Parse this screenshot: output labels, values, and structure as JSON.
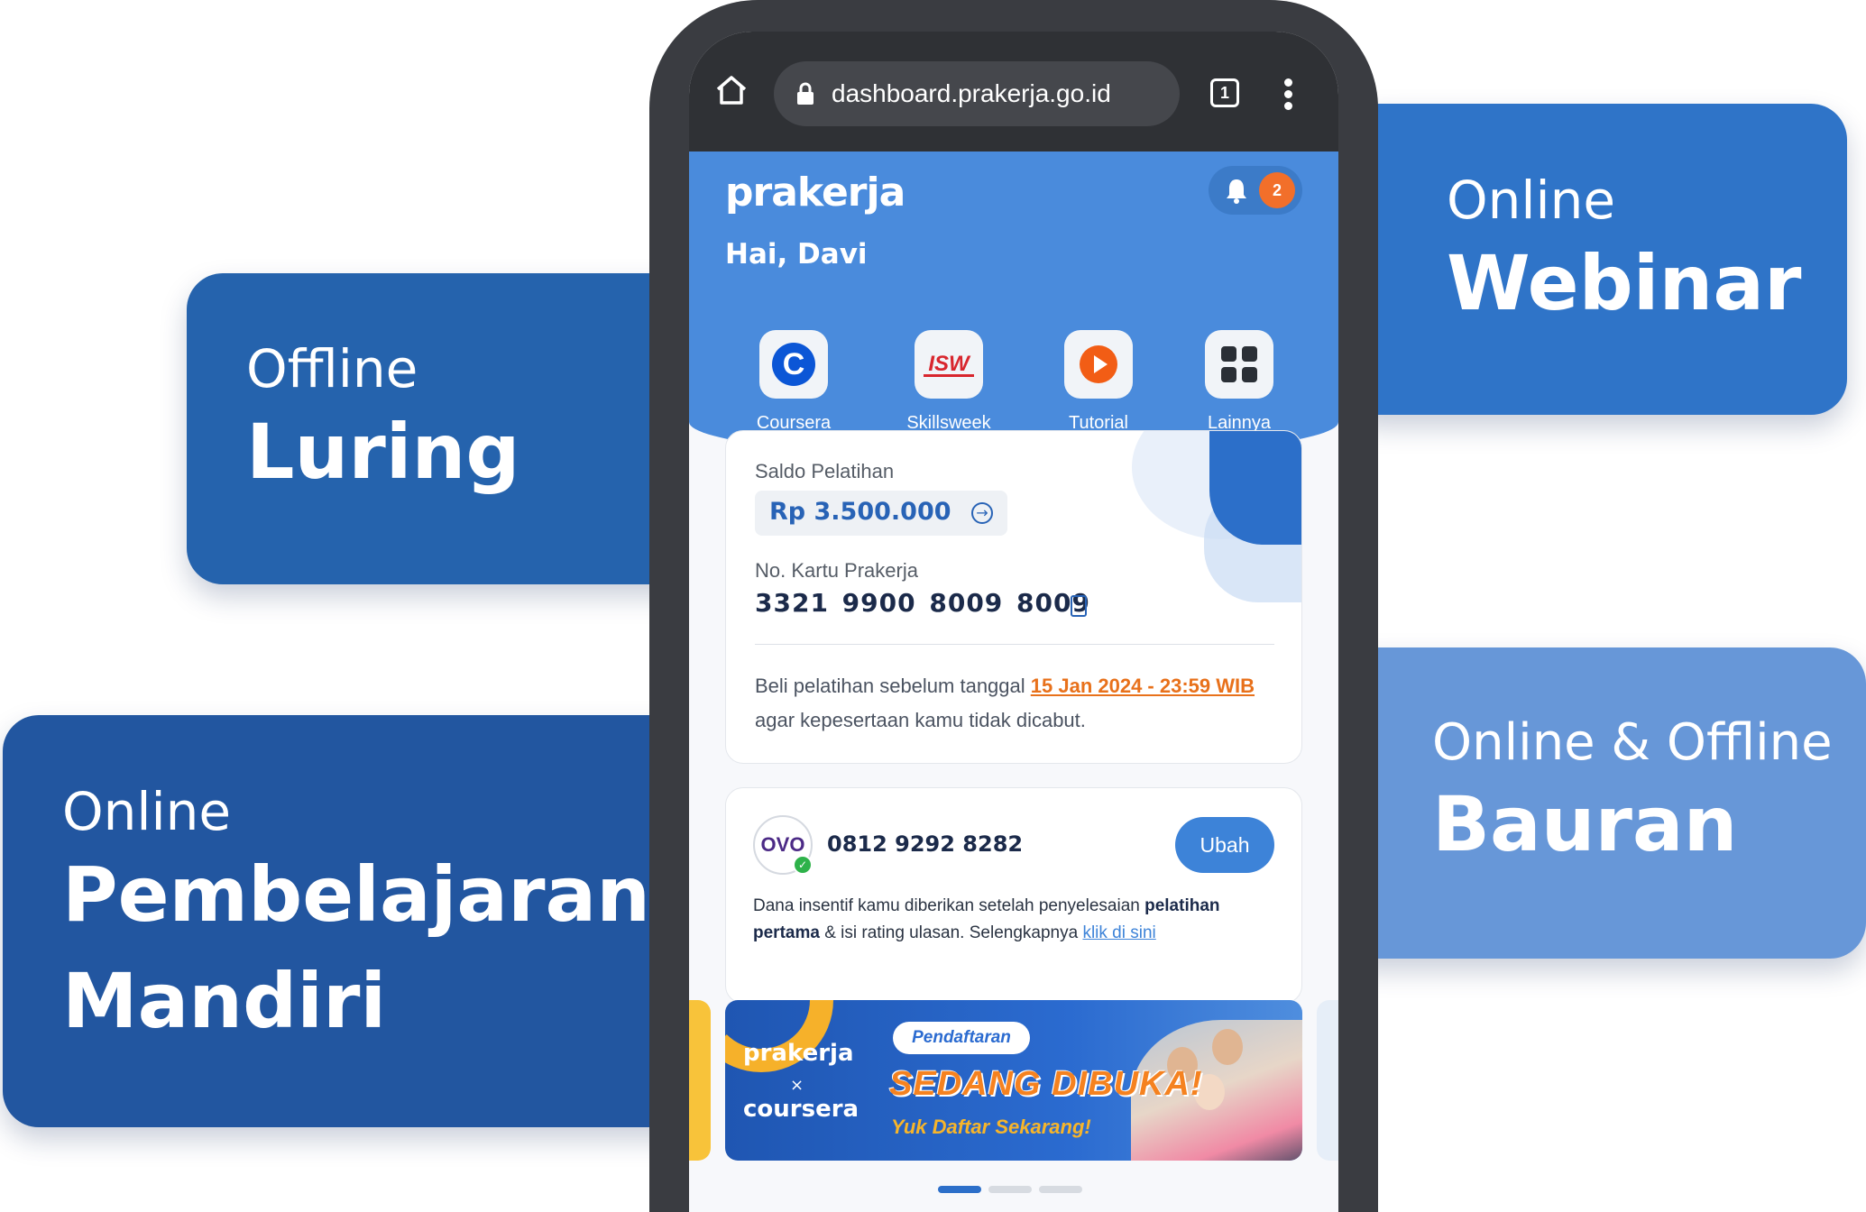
{
  "cards": {
    "luring": {
      "sub": "Offline",
      "main": "Luring"
    },
    "mandiri": {
      "sub": "Online",
      "main_line1": "Pembelajaran",
      "main_line2": "Mandiri"
    },
    "webinar": {
      "sub": "Online",
      "main": "Webinar"
    },
    "bauran": {
      "sub": "Online & Offline",
      "main": "Bauran"
    }
  },
  "browser": {
    "url": "dashboard.prakerja.go.id",
    "tab_count": "1",
    "icons": [
      "home-icon",
      "lock-icon",
      "tabs-icon",
      "menu-icon"
    ]
  },
  "app": {
    "logo": "prakerja",
    "notification_count": "2",
    "greeting": "Hai, Davi",
    "shortcuts": [
      {
        "label": "Coursera",
        "icon": "coursera-icon"
      },
      {
        "label": "Skillsweek",
        "icon": "skillsweek-icon",
        "glyph": "ISW"
      },
      {
        "label": "Tutorial",
        "icon": "play-icon"
      },
      {
        "label": "Lainnya",
        "icon": "grid-icon"
      }
    ]
  },
  "balance": {
    "label": "Saldo Pelatihan",
    "amount": "Rp 3.500.000",
    "card_label": "No. Kartu Prakerja",
    "card_number": "3321 9900 8009 8009",
    "note_prefix": "Beli pelatihan sebelum tanggal ",
    "deadline": "15 Jan 2024 - 23:59 WIB",
    "note_suffix": " agar kepesertaan kamu tidak dicabut."
  },
  "ovo": {
    "logo_text": "OVO",
    "phone": "0812 9292 8282",
    "button": "Ubah",
    "note_1": "Dana insentif kamu diberikan setelah penyelesaian ",
    "note_bold": "pelatihan pertama",
    "note_2": " & isi rating ulasan. Selengkapnya ",
    "link": "klik di sini"
  },
  "banner": {
    "logo": "prakerja",
    "x": "×",
    "partner": "coursera",
    "pill": "Pendaftaran",
    "headline": "SEDANG DIBUKA!",
    "subline": "Yuk Daftar Sekarang!"
  },
  "carousel": {
    "active_index": 0,
    "total": 3
  },
  "colors": {
    "primary_blue": "#4a8bdc",
    "accent_orange": "#f26f2a",
    "card_luring": "#2563ad",
    "card_mandiri": "#2256a0",
    "card_webinar": "#2f74c8",
    "card_bauran": "#6797d8"
  }
}
